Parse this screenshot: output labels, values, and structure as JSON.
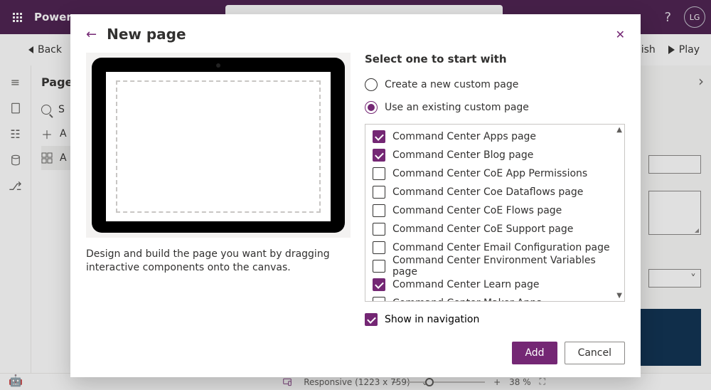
{
  "brand": "Power",
  "topbar": {
    "avatar_initials": "LG"
  },
  "commandbar": {
    "back": "Back",
    "publish_suffix": "ish",
    "play": "Play"
  },
  "pages_panel": {
    "title": "Page",
    "search_hint": "S",
    "add_label": "A",
    "row_label": "A"
  },
  "statusbar": {
    "responsive": "Responsive (1223 x 759)",
    "zoom_pct": "38 %"
  },
  "modal": {
    "title": "New page",
    "blurb": "Design and build the page you want by dragging interactive components onto the canvas.",
    "select_heading": "Select one to start with",
    "radio_new": "Create a new custom page",
    "radio_existing": "Use an existing custom page",
    "selected_radio": "existing",
    "show_in_nav": "Show in navigation",
    "show_in_nav_checked": true,
    "add_btn": "Add",
    "cancel_btn": "Cancel",
    "items": [
      {
        "label": "Command Center Apps page",
        "checked": true
      },
      {
        "label": "Command Center Blog page",
        "checked": true
      },
      {
        "label": "Command Center CoE App Permissions",
        "checked": false
      },
      {
        "label": "Command Center Coe Dataflows page",
        "checked": false
      },
      {
        "label": "Command Center CoE Flows page",
        "checked": false
      },
      {
        "label": "Command Center CoE Support page",
        "checked": false
      },
      {
        "label": "Command Center Email Configuration page",
        "checked": false
      },
      {
        "label": "Command Center Environment Variables page",
        "checked": false
      },
      {
        "label": "Command Center Learn page",
        "checked": true
      },
      {
        "label": "Command Center Maker Apps",
        "checked": false
      }
    ]
  },
  "colors": {
    "accent": "#742774"
  }
}
